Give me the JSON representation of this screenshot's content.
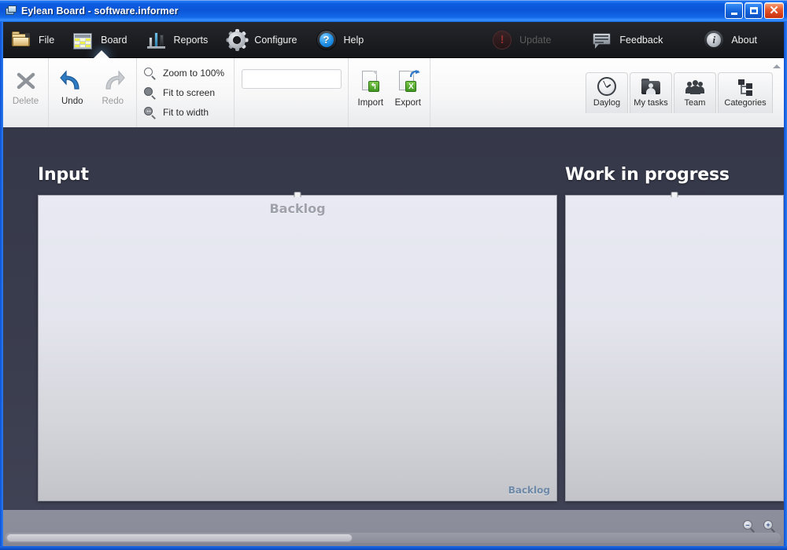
{
  "window": {
    "title": "Eylean Board - software.informer",
    "icon": "board-window-icon",
    "buttons": {
      "minimize": "_",
      "maximize": "□",
      "close": "✕"
    }
  },
  "menubar": {
    "items": [
      {
        "label": "File",
        "icon": "folder-icon",
        "active": false,
        "disabled": false
      },
      {
        "label": "Board",
        "icon": "grid-icon",
        "active": true,
        "disabled": false
      },
      {
        "label": "Reports",
        "icon": "bar-chart-icon",
        "active": false,
        "disabled": false
      },
      {
        "label": "Configure",
        "icon": "gear-icon",
        "active": false,
        "disabled": false
      },
      {
        "label": "Help",
        "icon": "question-mark-icon",
        "active": false,
        "disabled": false
      }
    ],
    "right_items": [
      {
        "label": "Update",
        "icon": "exclamation-circle-icon",
        "disabled": true
      },
      {
        "label": "Feedback",
        "icon": "speech-bubble-icon",
        "disabled": false
      },
      {
        "label": "About",
        "icon": "info-circle-icon",
        "disabled": false
      }
    ]
  },
  "ribbon": {
    "edit_group": [
      {
        "label": "Delete",
        "icon": "x-cross-icon",
        "disabled": true
      },
      {
        "label": "Undo",
        "icon": "undo-arrow-icon",
        "disabled": false
      },
      {
        "label": "Redo",
        "icon": "redo-arrow-icon",
        "disabled": true
      }
    ],
    "zoom_group": [
      {
        "label": "Zoom to 100%",
        "icon": "magnifier-icon"
      },
      {
        "label": "Fit to screen",
        "icon": "magnifier-filled-icon"
      },
      {
        "label": "Fit to width",
        "icon": "magnifier-width-icon"
      }
    ],
    "search": {
      "value": "",
      "placeholder": "",
      "icon": "search-icon"
    },
    "file_group": [
      {
        "label": "Import",
        "icon": "import-document-icon",
        "badge": "↰"
      },
      {
        "label": "Export",
        "icon": "export-excel-icon",
        "badge": "X"
      }
    ],
    "tools": [
      {
        "label": "Daylog",
        "icon": "clock-icon"
      },
      {
        "label": "My tasks",
        "icon": "folder-person-icon"
      },
      {
        "label": "Team",
        "icon": "people-group-icon"
      },
      {
        "label": "Categories",
        "icon": "hierarchy-icon"
      }
    ],
    "collapse_icon": "chevron-up-icon"
  },
  "board": {
    "columns": [
      {
        "title": "Input",
        "panel_center_label": "Backlog",
        "panel_corner_label": "Backlog"
      },
      {
        "title": "Work in progress",
        "panel_center_label": "",
        "panel_corner_label": ""
      }
    ]
  },
  "statusbar": {
    "zoom_out_icon": "zoom-out-icon",
    "zoom_out_glyph": "–",
    "zoom_in_icon": "zoom-in-icon",
    "zoom_in_glyph": "+",
    "scrollbar": "horizontal-scrollbar"
  },
  "colors": {
    "titlebar_blue": "#0b55d8",
    "menubar_dark": "#1c1e22",
    "board_background": "#3a3d4e",
    "panel_top": "#e8e9f2",
    "panel_bottom": "#c2c4c9",
    "corner_label_blue": "#6f8aa8",
    "close_red": "#e4562a"
  }
}
